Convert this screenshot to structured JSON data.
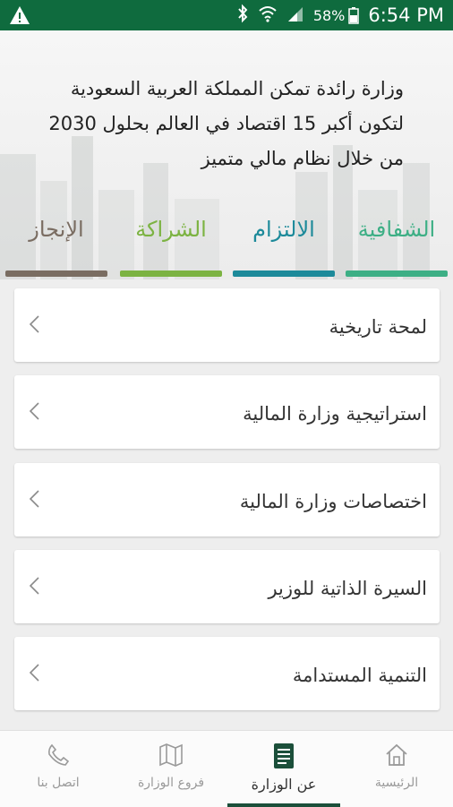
{
  "status_bar": {
    "time": "6:54 PM",
    "battery": "58%",
    "color": "#0f6b3e"
  },
  "hero": {
    "vision_lines": [
      "وزارة رائدة تمكن المملكة العربية السعودية",
      "لتكون أكبر 15 اقتصاد في العالم بحلول 2030",
      "من خلال نظام مالي متميز"
    ]
  },
  "values": [
    {
      "label": "الشفافية",
      "color": "#3daf85"
    },
    {
      "label": "الالتزام",
      "color": "#1d8a9a"
    },
    {
      "label": "الشراكة",
      "color": "#7cb342"
    },
    {
      "label": "الإنجاز",
      "color": "#7a6d62"
    }
  ],
  "menu": [
    {
      "label": "لمحة تاريخية"
    },
    {
      "label": "استراتيجية وزارة المالية"
    },
    {
      "label": "اختصاصات وزارة المالية"
    },
    {
      "label": "السيرة الذاتية للوزير"
    },
    {
      "label": "التنمية المستدامة"
    }
  ],
  "bottom_nav": [
    {
      "label": "الرئيسية",
      "icon": "home-icon",
      "active": false
    },
    {
      "label": "عن الوزارة",
      "icon": "document-icon",
      "active": true
    },
    {
      "label": "فروع الوزارة",
      "icon": "map-icon",
      "active": false
    },
    {
      "label": "اتصل بنا",
      "icon": "phone-icon",
      "active": false
    }
  ]
}
